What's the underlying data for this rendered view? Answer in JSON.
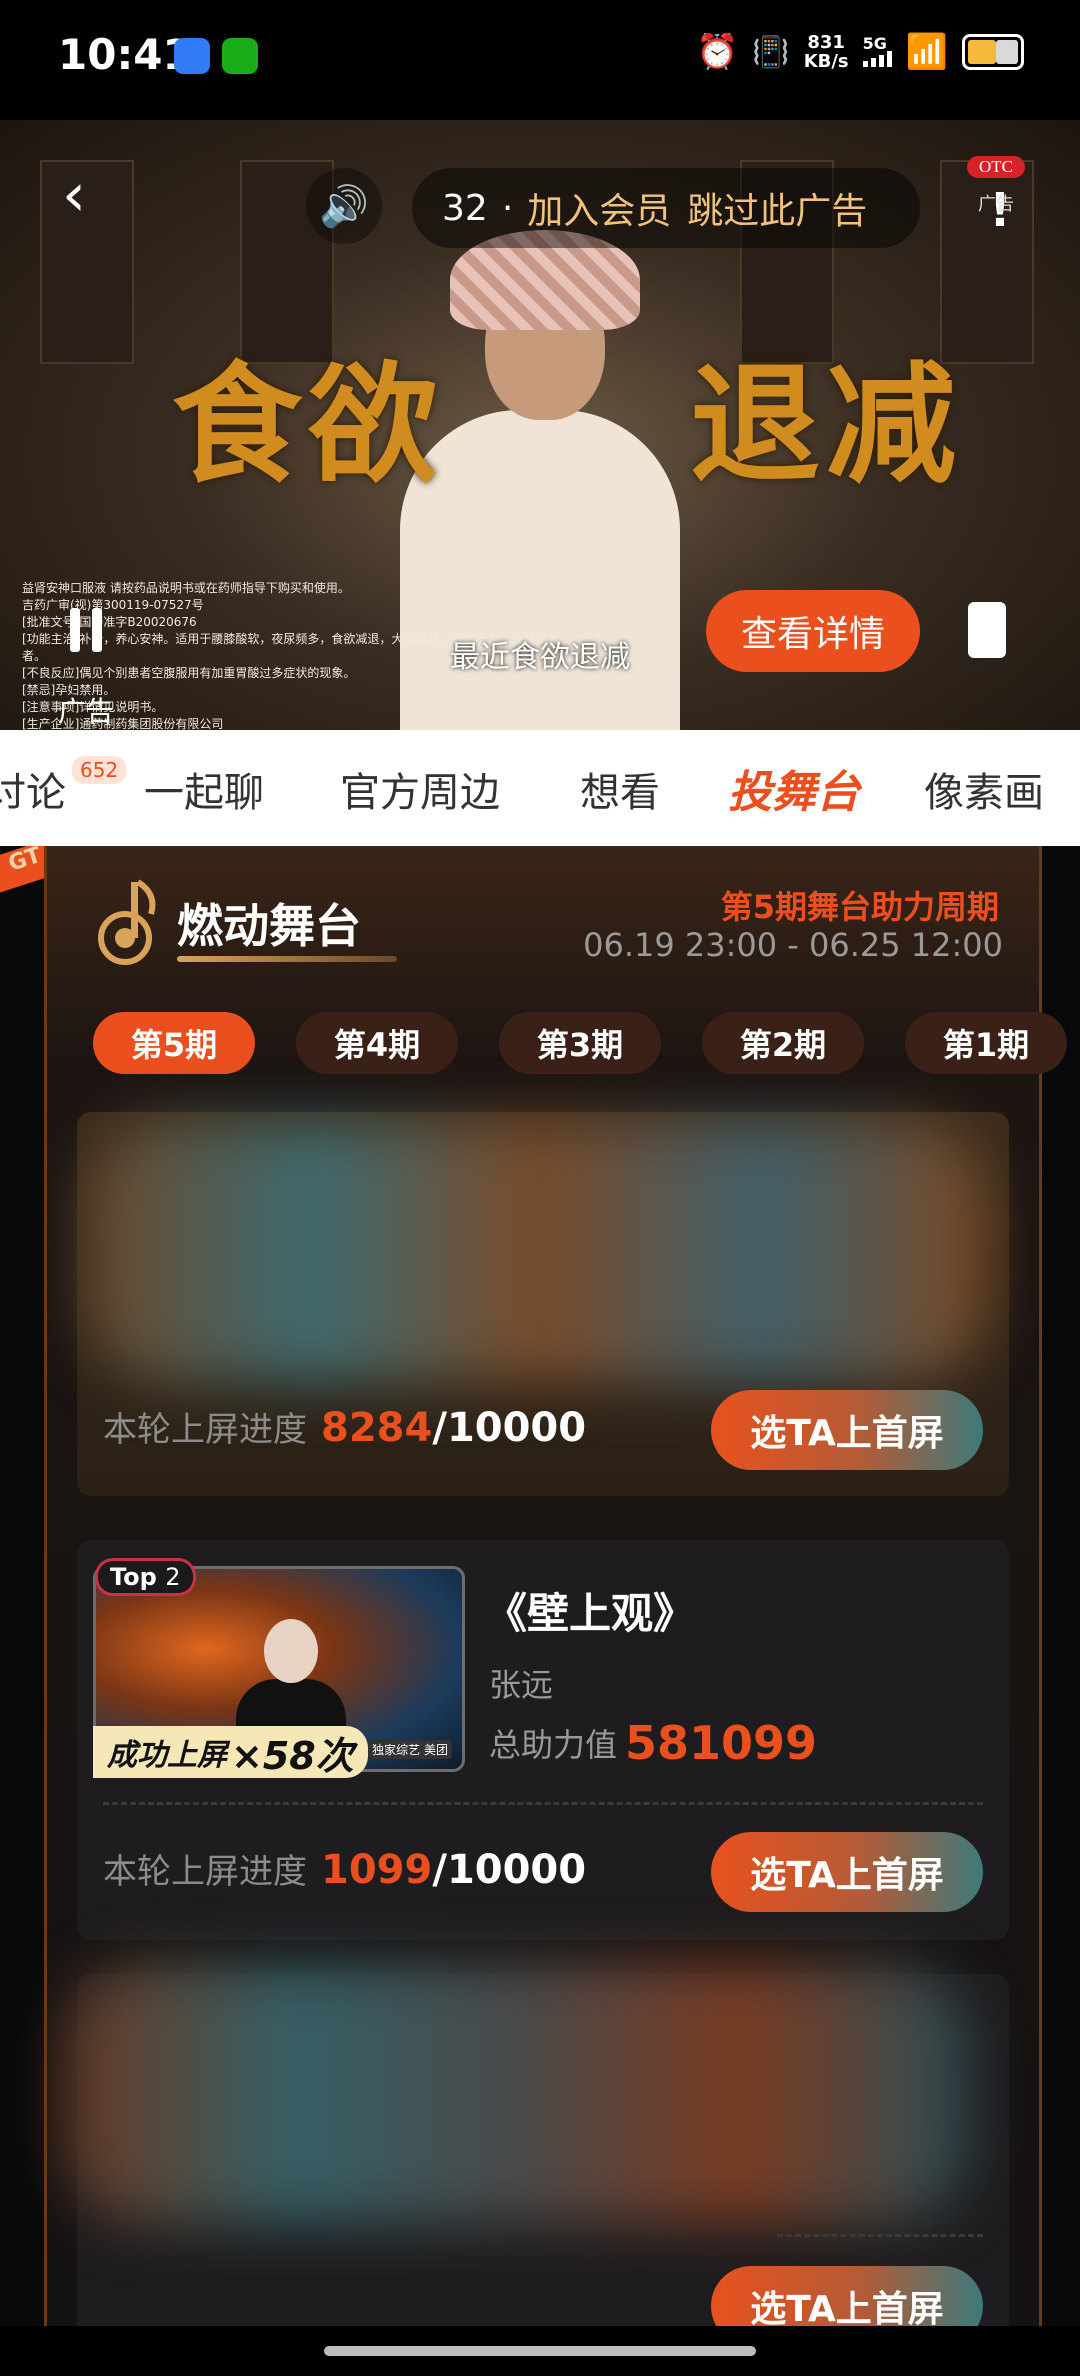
{
  "status_bar": {
    "time": "10:41",
    "net_speed_value": "831",
    "net_speed_unit": "KB/s",
    "network": "5G",
    "battery_level": 0.55
  },
  "ad": {
    "countdown": "32",
    "separator": "·",
    "vip_text": "加入会员",
    "skip_text": "跳过此广告",
    "otc_label": "OTC",
    "otc_sub": "广告",
    "headline_left": "食欲",
    "headline_right": "退减",
    "subtitle": "最近食欲退减",
    "detail_button": "查看详情",
    "ad_label": "广告",
    "legal_lines": [
      "益肾安神口服液 请按药品说明书或在药师指导下购买和使用。",
      "吉药广审(视)第300119-07527号",
      "[批准文号]国药准字B20020676",
      "[功能主治]补肾，养心安神。适用于腰膝酸软，夜尿频多，食欲减退，大便稀溏，神疲乏力，失眠健忘者。",
      "[不良反应]偶见个别患者空腹服用有加重胃酸过多症状的现象。",
      "[禁忌]孕妇禁用。",
      "[注意事项]详情见说明书。",
      "[生产企业]通药制药集团股份有限公司"
    ]
  },
  "tabs": [
    {
      "label": "讨论",
      "badge": "652"
    },
    {
      "label": "一起聊"
    },
    {
      "label": "官方周边"
    },
    {
      "label": "想看"
    },
    {
      "label": "投舞台",
      "active": true
    },
    {
      "label": "像素画"
    }
  ],
  "ribbon": "GT",
  "stage": {
    "title": "燃动舞台",
    "period_title": "第5期舞台助力周期",
    "period_range": "06.19 23:00 - 06.25 12:00",
    "periods": [
      "第5期",
      "第4期",
      "第3期",
      "第2期",
      "第1期"
    ],
    "progress_label": "本轮上屏进度",
    "pick_button": "选TA上首屏",
    "cards": [
      {
        "progress_current": "8284",
        "progress_total": "/10000"
      },
      {
        "rank_label": "Top",
        "rank": "2",
        "thumb_title": "《壁上观》",
        "thumb_corner": "独家综艺 美团",
        "success_label": "成功上屏",
        "success_count": "×58次",
        "song": "《壁上观》",
        "artist": "张远",
        "power_label": "总助力值",
        "power_value": "581099",
        "progress_current": "1099",
        "progress_total": "/10000"
      },
      {}
    ]
  },
  "colors": {
    "accent": "#ea4f1d",
    "dark_bg": "#151213",
    "card_bg": "#1e1c1e"
  }
}
